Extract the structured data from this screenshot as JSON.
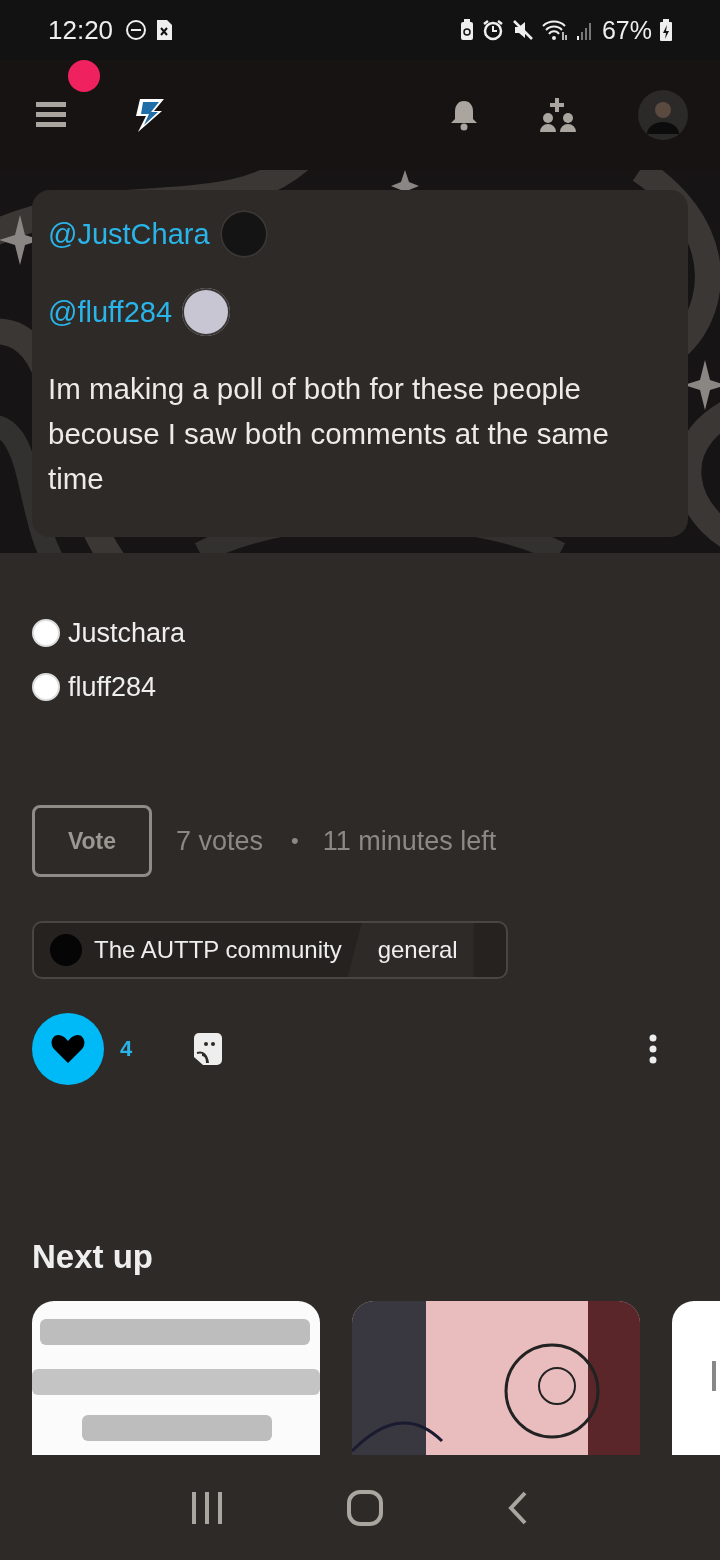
{
  "status_bar": {
    "time": "12:20",
    "battery": "67%"
  },
  "top_bar": {
    "notification_dot": true
  },
  "post": {
    "mentions": [
      {
        "handle": "@JustChara"
      },
      {
        "handle": "@fluff284"
      }
    ],
    "text": "Im making a poll of both for these people becouse I saw both comments at the same time"
  },
  "poll": {
    "options": [
      {
        "label": "Justchara",
        "selected": false
      },
      {
        "label": "fluff284",
        "selected": false
      }
    ],
    "vote_button": "Vote",
    "votes": "7 votes",
    "separator": "•",
    "time_left": "11 minutes left"
  },
  "community": {
    "name": "The AUTTP community",
    "channel": "general"
  },
  "actions": {
    "liked": true,
    "likes": "4"
  },
  "next_up": {
    "title": "Next up"
  }
}
